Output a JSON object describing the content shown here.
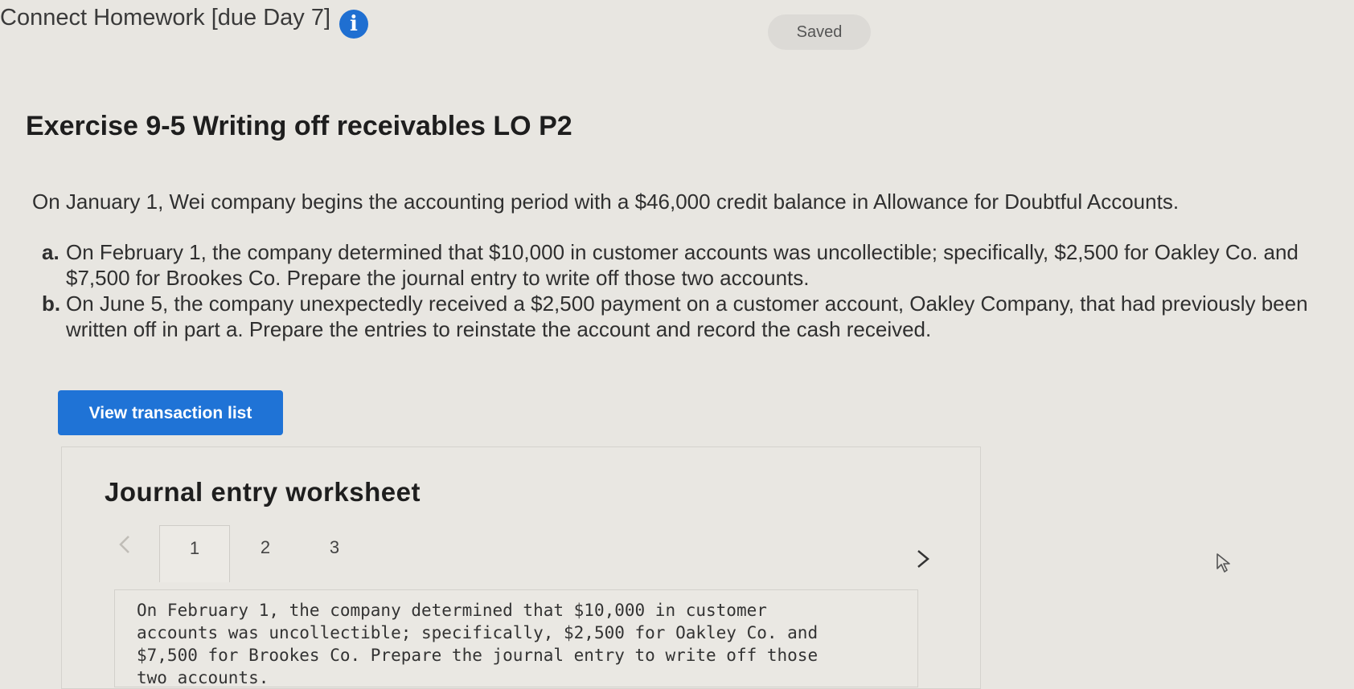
{
  "header": {
    "title": "Connect Homework [due Day 7]",
    "info_icon": "info-icon",
    "status": "Saved"
  },
  "exercise": {
    "title": "Exercise 9-5 Writing off receivables LO P2",
    "intro": "On January 1, Wei company begins the accounting period with a $46,000 credit balance in Allowance for Doubtful Accounts.",
    "parts": [
      {
        "letter": "a.",
        "text": "On February 1, the company determined that $10,000 in customer accounts was uncollectible; specifically, $2,500 for Oakley Co. and $7,500 for Brookes Co. Prepare the journal entry to write off those two accounts."
      },
      {
        "letter": "b.",
        "text": "On June 5, the company unexpectedly received a $2,500 payment on a customer account, Oakley Company, that had previously been written off in part a. Prepare the entries to reinstate the account and record the cash received."
      }
    ]
  },
  "actions": {
    "view_transactions_label": "View transaction list"
  },
  "worksheet": {
    "title": "Journal entry worksheet",
    "prev_icon": "chevron-left-icon",
    "next_icon": "chevron-right-icon",
    "tabs": [
      "1",
      "2",
      "3"
    ],
    "active_tab": "1",
    "instruction": "On February 1, the company determined that $10,000 in customer accounts was uncollectible; specifically, $2,500 for Oakley Co. and $7,500 for Brookes Co. Prepare the journal entry to write off those two accounts."
  },
  "colors": {
    "accent": "#1f73d6",
    "background": "#e8e6e1"
  }
}
